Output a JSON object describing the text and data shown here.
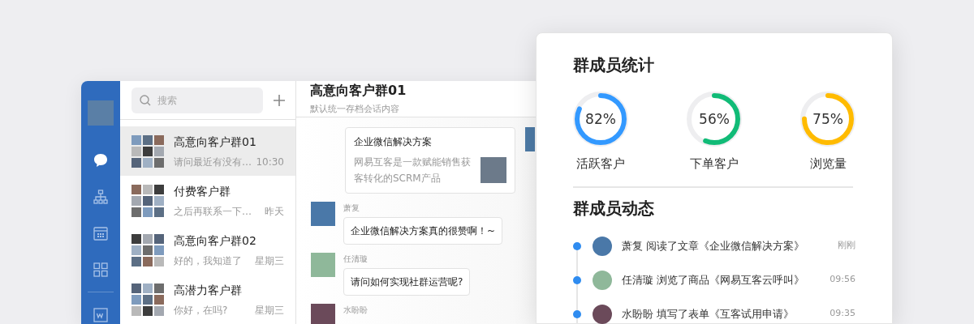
{
  "sidebar": {
    "nav": [
      {
        "kind": "chat",
        "selected": true
      },
      {
        "kind": "org",
        "selected": false
      },
      {
        "kind": "calendar",
        "selected": false
      },
      {
        "kind": "apps",
        "selected": false
      },
      {
        "kind": "doc",
        "selected": false
      }
    ]
  },
  "conversation_list": {
    "search": {
      "placeholder": "搜索"
    },
    "items": [
      {
        "name": "高意向客户群01",
        "preview": "请问最近有没有…",
        "time": "10:30",
        "selected": true
      },
      {
        "name": "付费客户群",
        "preview": "之后再联系一下…",
        "time": "昨天",
        "selected": false
      },
      {
        "name": "高意向客户群02",
        "preview": "好的，我知道了",
        "time": "星期三",
        "selected": false
      },
      {
        "name": "高潜力客户群",
        "preview": "你好，在吗?",
        "time": "星期三",
        "selected": false
      }
    ]
  },
  "chat": {
    "title": "高意向客户群01",
    "subtitle": "默认统一存档会话内容",
    "messages": [
      {
        "kind": "card",
        "title": "企业微信解决方案",
        "description": "网易互客是一款赋能销售获客转化的SCRM产品"
      },
      {
        "kind": "text",
        "sender": "萧复",
        "text": "企业微信解决方案真的很赞啊！~"
      },
      {
        "kind": "text",
        "sender": "任清璇",
        "text": "请问如何实现社群运营呢?"
      },
      {
        "kind": "text",
        "sender": "水盼盼"
      }
    ]
  },
  "stats_card": {
    "title": "群成员统计",
    "stats": [
      {
        "value": "82%",
        "label": "活跃客户",
        "level": 0.82,
        "color": "#3399ff"
      },
      {
        "value": "56%",
        "label": "下单客户",
        "level": 0.56,
        "color": "#11bb77"
      },
      {
        "value": "75%",
        "label": "浏览量",
        "level": 0.75,
        "color": "#ffbb00"
      }
    ],
    "activity_title": "群成员动态",
    "activities": [
      {
        "text": "萧复 阅读了文章《企业微信解决方案》",
        "time": "刚刚"
      },
      {
        "text": "任清璇 浏览了商品《网易互客云呼叫》",
        "time": "09:56"
      },
      {
        "text": "水盼盼 填写了表单《互客试用申请》",
        "time": "09:35"
      }
    ]
  }
}
